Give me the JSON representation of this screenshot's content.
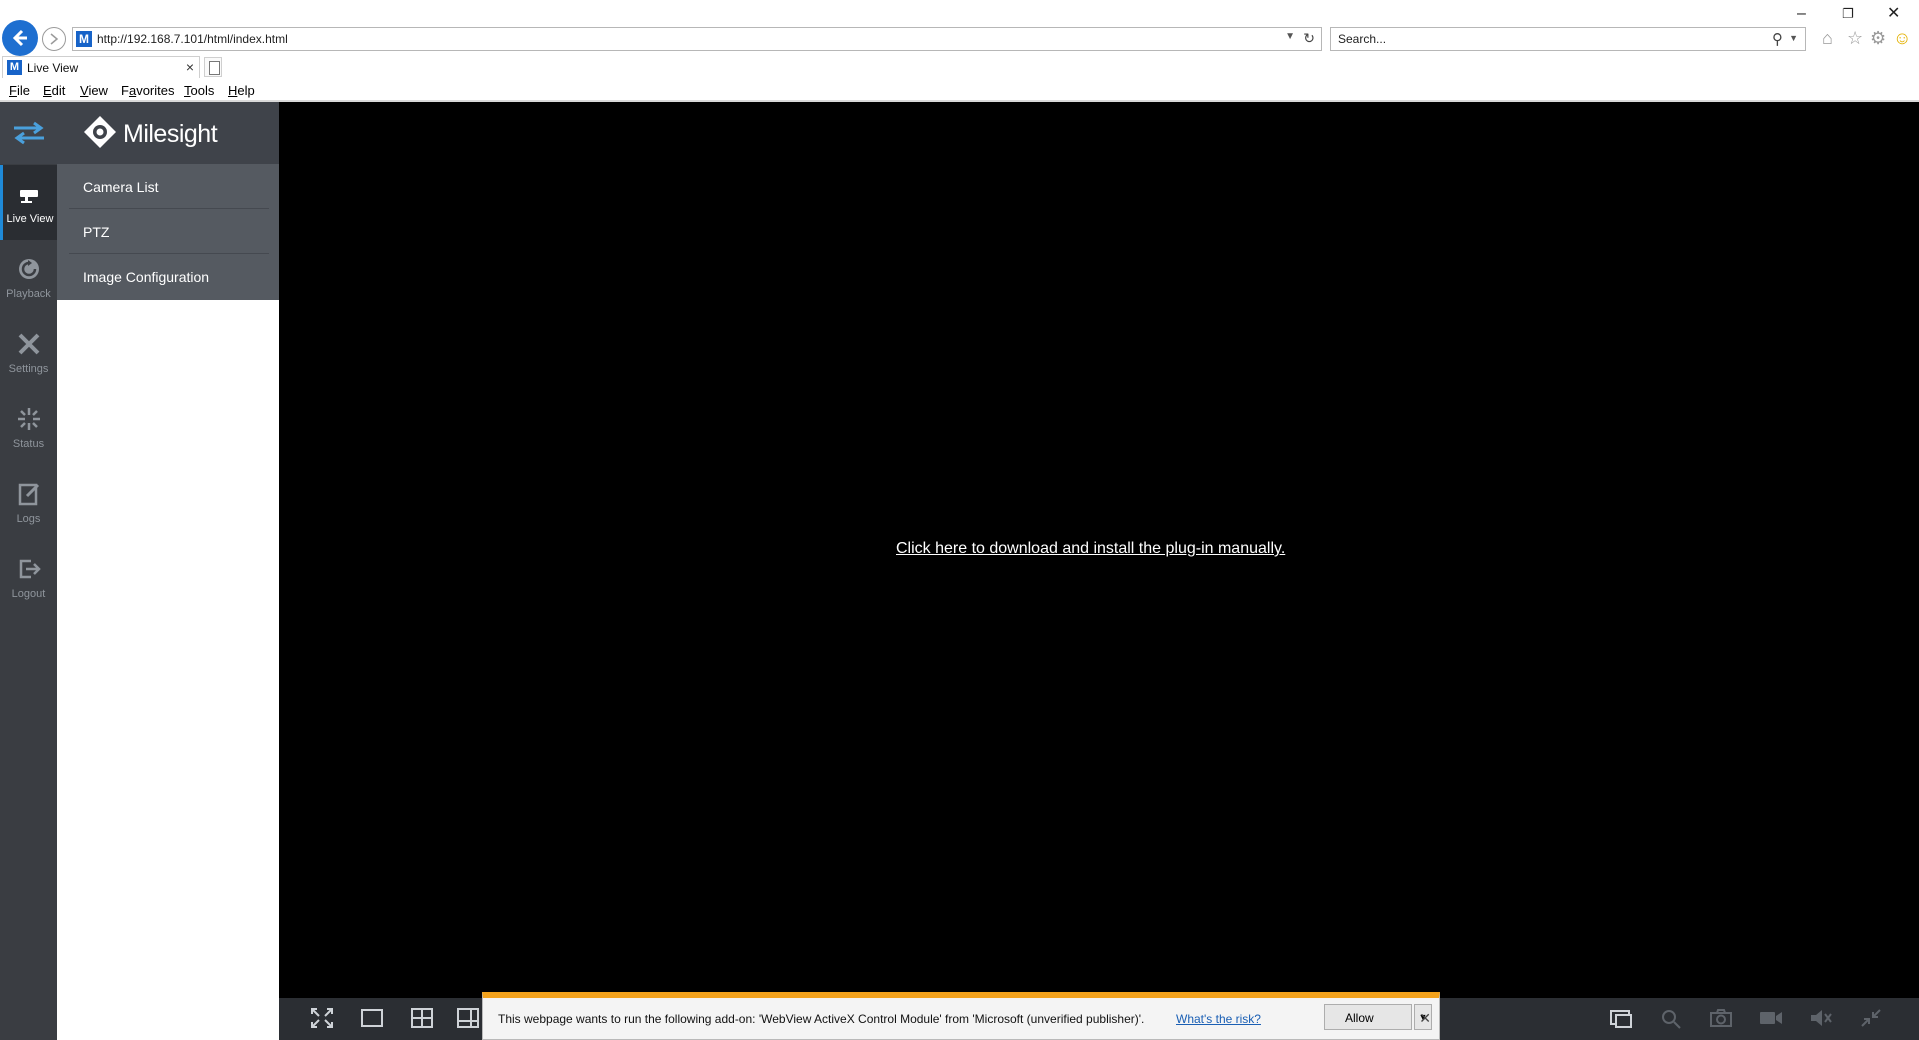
{
  "browser": {
    "url": "http://192.168.7.101/html/index.html",
    "search_placeholder": "Search...",
    "favicon_letter": "M",
    "tab_title": "Live View",
    "menu": [
      "File",
      "Edit",
      "View",
      "Favorites",
      "Tools",
      "Help"
    ],
    "menu_mnemonics": [
      "F",
      "E",
      "V",
      "a",
      "T",
      "H"
    ]
  },
  "app": {
    "logo_text": "Milesight",
    "nav": [
      {
        "label": "Live View",
        "icon": "camera-icon",
        "active": true
      },
      {
        "label": "Playback",
        "icon": "playback-icon",
        "active": false
      },
      {
        "label": "Settings",
        "icon": "wrench-icon",
        "active": false
      },
      {
        "label": "Status",
        "icon": "status-icon",
        "active": false
      },
      {
        "label": "Logs",
        "icon": "logs-icon",
        "active": false
      },
      {
        "label": "Logout",
        "icon": "logout-icon",
        "active": false
      }
    ],
    "submenu": [
      "Camera List",
      "PTZ",
      "Image Configuration"
    ],
    "plugin_link": "Click here to download and install the plug-in manually."
  },
  "notification": {
    "text": "This webpage wants to run the following add-on: 'WebView ActiveX Control Module' from 'Microsoft (unverified publisher)'.",
    "link": "What's the risk?",
    "allow": "Allow",
    "accent_color": "#f3a21c"
  }
}
